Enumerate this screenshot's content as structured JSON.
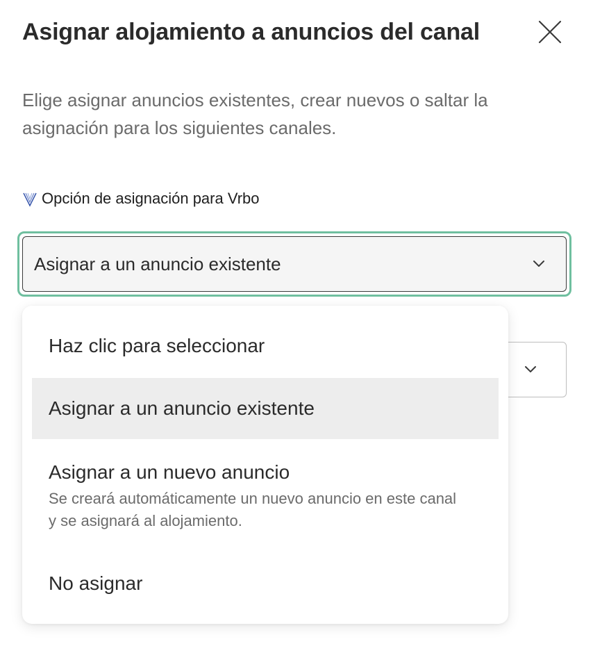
{
  "dialog": {
    "title": "Asignar alojamiento a anuncios del canal",
    "subtitle": "Elige asignar anuncios existentes, crear nuevos o saltar la asignación para los siguientes canales."
  },
  "channel": {
    "label": "Opción de asignación para Vrbo",
    "logo_icon": "vrbo-logo"
  },
  "select": {
    "value": "Asignar a un anuncio existente"
  },
  "dropdown": {
    "options": [
      {
        "label": "Haz clic para seleccionar",
        "description": ""
      },
      {
        "label": "Asignar a un anuncio existente",
        "description": ""
      },
      {
        "label": "Asignar a un nuevo anuncio",
        "description": "Se creará automáticamente un nuevo anuncio en este canal y se asignará al alojamiento."
      },
      {
        "label": "No asignar",
        "description": ""
      }
    ]
  },
  "colors": {
    "focus_ring": "#6fbf9f",
    "highlight": "#ededed"
  }
}
